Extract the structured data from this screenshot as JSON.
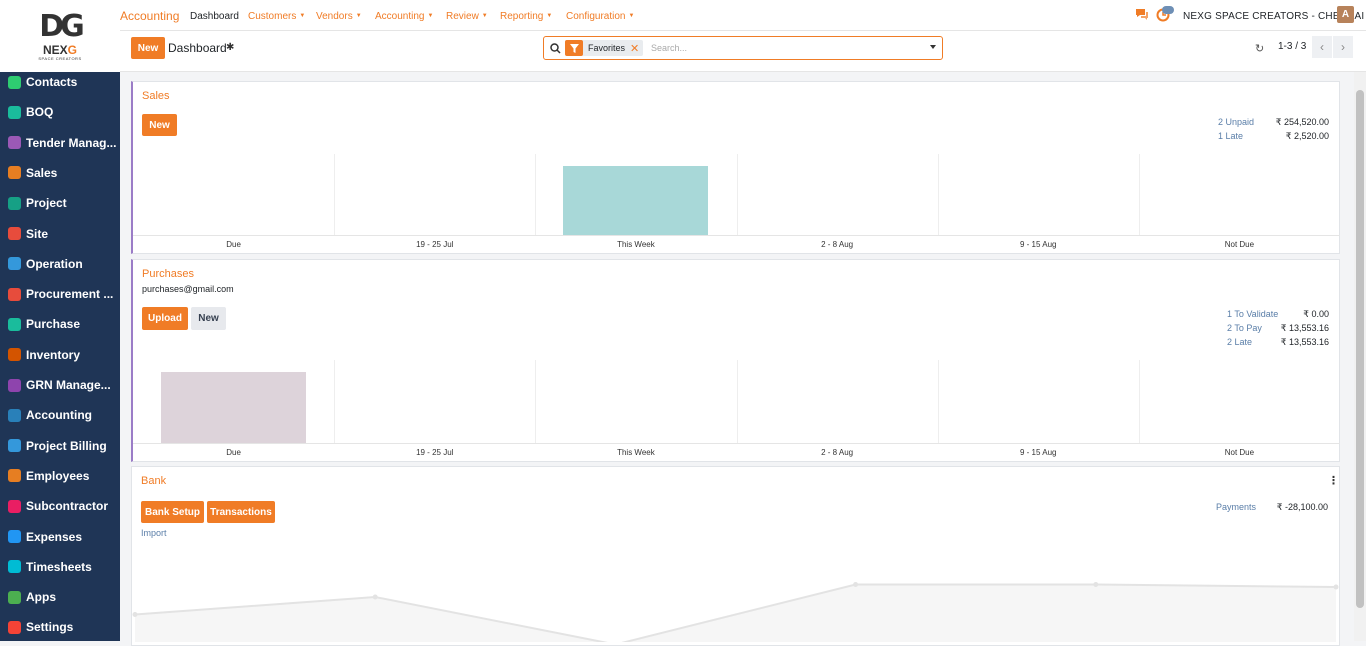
{
  "logo": {
    "mark": "DG",
    "brand_main": "NEX",
    "brand_accent": "G",
    "tagline": "SPACE CREATORS"
  },
  "sidebar": {
    "items": [
      {
        "label": "Contacts",
        "color": "#2ecc71"
      },
      {
        "label": "BOQ",
        "color": "#1abc9c"
      },
      {
        "label": "Tender Manag...",
        "color": "#9b59b6"
      },
      {
        "label": "Sales",
        "color": "#e67e22"
      },
      {
        "label": "Project",
        "color": "#16a085"
      },
      {
        "label": "Site",
        "color": "#e74c3c"
      },
      {
        "label": "Operation",
        "color": "#3498db"
      },
      {
        "label": "Procurement ...",
        "color": "#e74c3c"
      },
      {
        "label": "Purchase",
        "color": "#1abc9c"
      },
      {
        "label": "Inventory",
        "color": "#d35400"
      },
      {
        "label": "GRN Manage...",
        "color": "#8e44ad"
      },
      {
        "label": "Accounting",
        "color": "#2980b9"
      },
      {
        "label": "Project Billing",
        "color": "#3498db"
      },
      {
        "label": "Employees",
        "color": "#e67e22"
      },
      {
        "label": "Subcontractor",
        "color": "#e91e63"
      },
      {
        "label": "Expenses",
        "color": "#2196f3"
      },
      {
        "label": "Timesheets",
        "color": "#00bcd4"
      },
      {
        "label": "Apps",
        "color": "#4caf50"
      },
      {
        "label": "Settings",
        "color": "#f44336"
      }
    ]
  },
  "topbar": {
    "app": "Accounting",
    "menus": [
      "Dashboard",
      "Customers",
      "Vendors",
      "Accounting",
      "Review",
      "Reporting",
      "Configuration"
    ],
    "company": "NEXG SPACE CREATORS - CHENNAI",
    "avatar": "A"
  },
  "control": {
    "new_label": "New",
    "breadcrumb": "Dashboard",
    "facet": "Favorites",
    "search_placeholder": "Search...",
    "pager": "1-3 / 3"
  },
  "sales": {
    "title": "Sales",
    "new_label": "New",
    "stats": [
      {
        "label": "2 Unpaid",
        "value": "₹ 254,520.00"
      },
      {
        "label": "1 Late",
        "value": "₹ 2,520.00"
      }
    ]
  },
  "purchases": {
    "title": "Purchases",
    "email": "purchases@gmail.com",
    "upload_label": "Upload",
    "new_label": "New",
    "stats": [
      {
        "label": "1 To Validate",
        "value": "₹ 0.00"
      },
      {
        "label": "2 To Pay",
        "value": "₹ 13,553.16"
      },
      {
        "label": "2 Late",
        "value": "₹ 13,553.16"
      }
    ]
  },
  "bank": {
    "title": "Bank",
    "setup_label": "Bank Setup",
    "transactions_label": "Transactions",
    "import_label": "Import",
    "stats": [
      {
        "label": "Payments",
        "value": "₹ -28,100.00"
      }
    ]
  },
  "chart_data": [
    {
      "type": "bar",
      "categories": [
        "Due",
        "19 - 25 Jul",
        "This Week",
        "2 - 8 Aug",
        "9 - 15 Aug",
        "Not Due"
      ],
      "values": [
        0,
        0,
        1,
        0,
        0,
        0
      ],
      "color": "#a8d8d8"
    },
    {
      "type": "bar",
      "categories": [
        "Due",
        "19 - 25 Jul",
        "This Week",
        "2 - 8 Aug",
        "9 - 15 Aug",
        "Not Due"
      ],
      "values": [
        1,
        0,
        0,
        0,
        0,
        0
      ],
      "color": "#ddd3da"
    },
    {
      "type": "line",
      "categories": [
        "",
        "",
        "",
        "",
        "",
        ""
      ],
      "values": [
        0.45,
        0.8,
        -0.15,
        1.05,
        1.05,
        1.0
      ],
      "color": "#eeeeee"
    }
  ]
}
